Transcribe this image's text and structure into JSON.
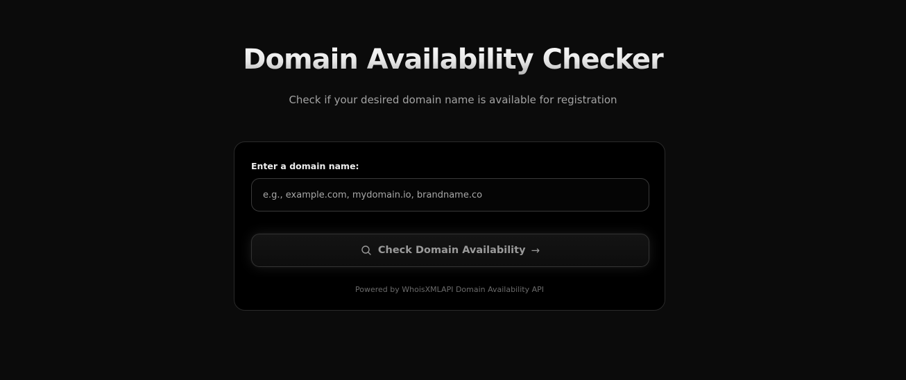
{
  "header": {
    "title": "Domain Availability Checker",
    "subtitle": "Check if your desired domain name is available for registration"
  },
  "form": {
    "label": "Enter a domain name:",
    "input_value": "",
    "input_placeholder": "e.g., example.com, mydomain.io, brandname.co",
    "button_label": "Check Domain Availability",
    "button_icon": "search-icon",
    "button_trailing_glyph": "→"
  },
  "footer": {
    "note": "Powered by WhoisXMLAPI Domain Availability API"
  },
  "colors": {
    "background": "#0b0b0b",
    "card": "#000000",
    "border": "#2a2a2a",
    "muted_text": "#a3a3a3"
  }
}
